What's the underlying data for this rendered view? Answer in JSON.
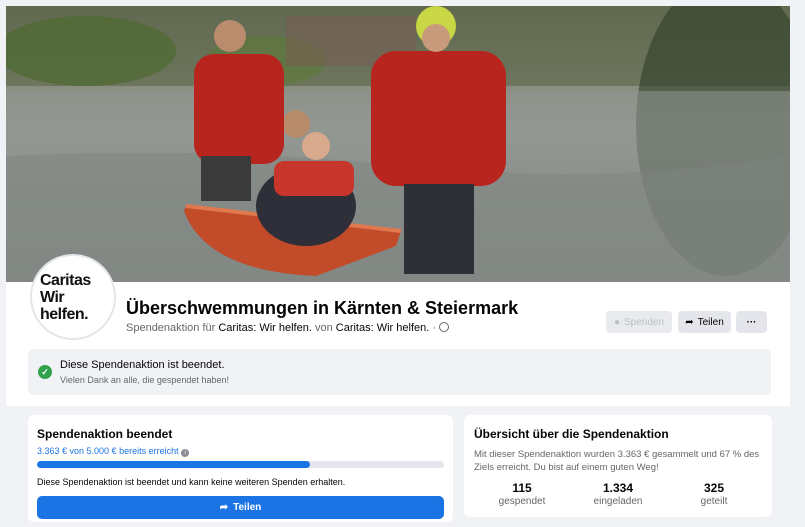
{
  "page": {
    "title": "Überschwemmungen in Kärnten & Steiermark",
    "subtitle_prefix": "Spendenaktion für",
    "org_name_1": "Caritas: Wir helfen.",
    "subtitle_mid": "von",
    "org_name_2": "Caritas: Wir helfen.",
    "subtitle_dot": "·"
  },
  "avatar": {
    "line1": "Caritas",
    "line2": "Wir helfen."
  },
  "actions": {
    "spenden_label": "Spenden",
    "teilen_label": "Teilen",
    "more_label": "···"
  },
  "notice": {
    "title": "Diese Spendenaktion ist beendet.",
    "subtitle": "Vielen Dank an alle, die gespendet haben!"
  },
  "fundraiser": {
    "title": "Spendenaktion beendet",
    "raised_text": "3.363 € von 5.000 € bereits erreicht",
    "progress_fraction": 0.67,
    "note": "Diese Spendenaktion ist beendet und kann keine weiteren Spenden erhalten.",
    "share_label": "Teilen"
  },
  "overview": {
    "title": "Übersicht über die Spendenaktion",
    "text": "Mit dieser Spendenaktion wurden 3.363 € gesammelt und 67 % des Ziels erreicht. Du bist auf einem guten Weg!",
    "stats": [
      {
        "value": "115",
        "label": "gespendet"
      },
      {
        "value": "1.334",
        "label": "eingeladen"
      },
      {
        "value": "325",
        "label": "geteilt"
      }
    ]
  },
  "colors": {
    "accent": "#1b74e4",
    "success": "#31a24c"
  },
  "icons": [
    "check-icon",
    "globe-icon",
    "share-icon",
    "donate-icon",
    "info-icon",
    "more-icon"
  ]
}
